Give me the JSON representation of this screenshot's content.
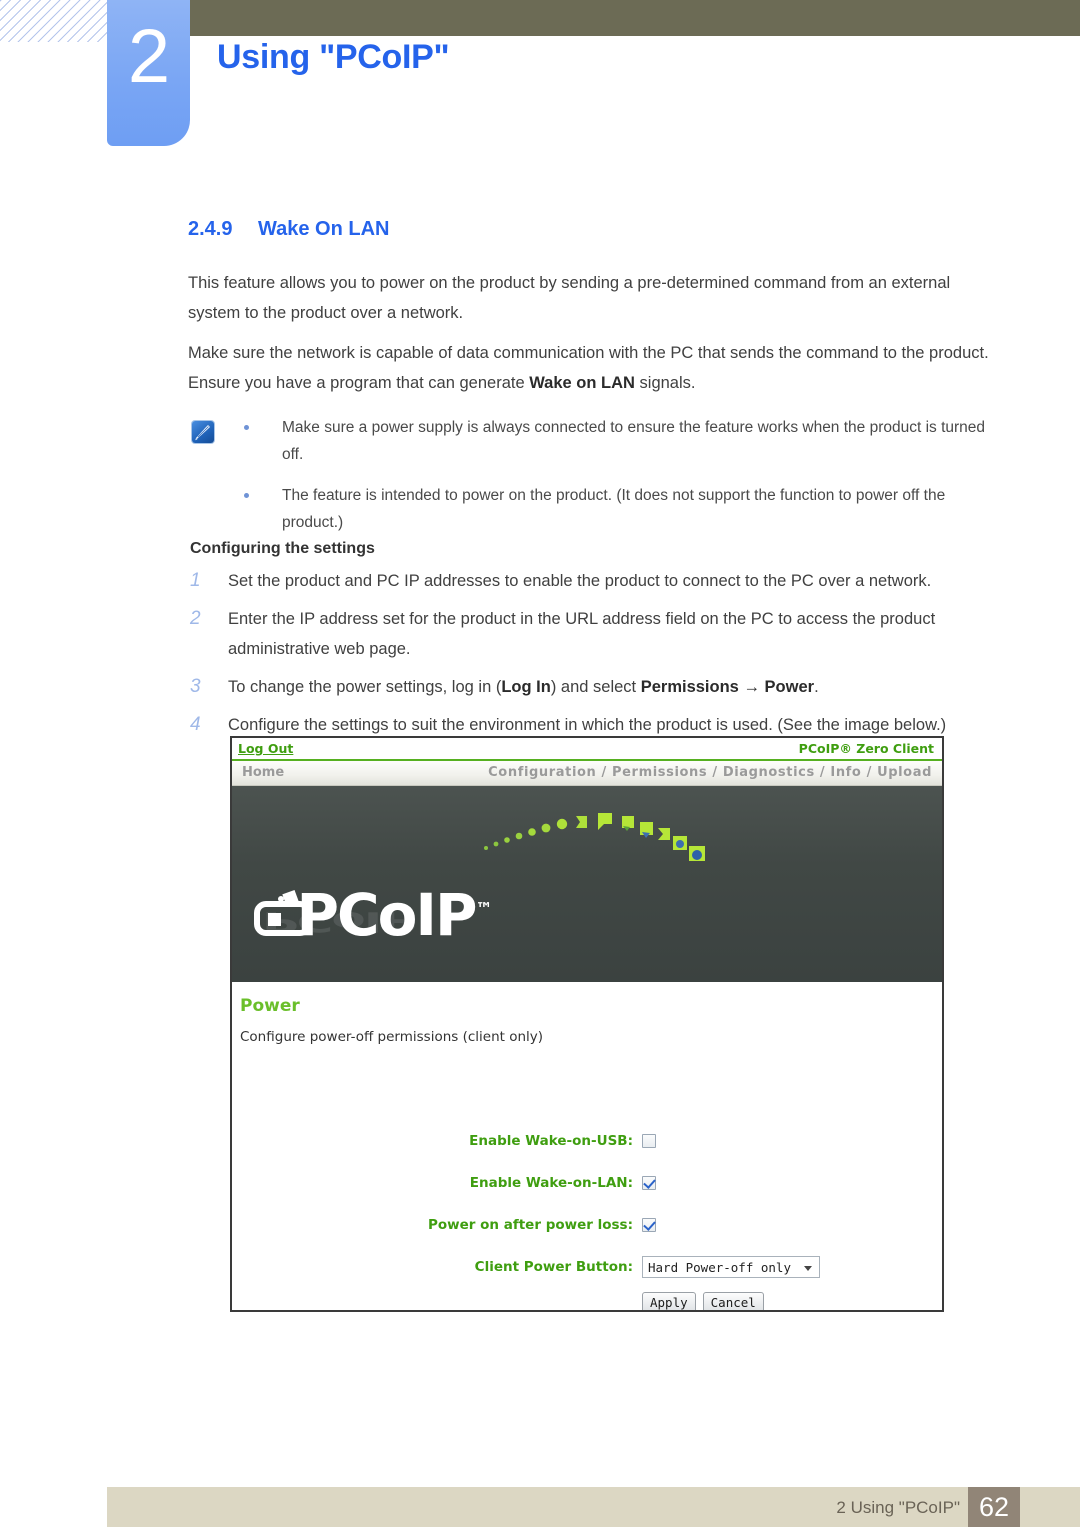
{
  "header": {
    "chapter_number": "2",
    "chapter_title": "Using \"PCoIP\"",
    "accent_blue": "#2563eb",
    "olive": "#6c6b55"
  },
  "section": {
    "number": "2.4.9",
    "title": "Wake On LAN"
  },
  "paragraphs": {
    "p1": "This feature allows you to power on the product by sending a pre-determined command from an external system to the product over a network.",
    "p2_before": "Make sure the network is capable of data communication with the PC that sends the command to the product. Ensure you have a program that can generate ",
    "p2_bold": "Wake on LAN",
    "p2_after": " signals."
  },
  "note": {
    "icon": "note-pen-icon",
    "items": [
      "Make sure a power supply is always connected to ensure the feature works when the product is turned off.",
      "The feature is intended to power on the product. (It does not support the function to power off the product.)"
    ]
  },
  "steps": {
    "title": "Configuring the settings",
    "items": [
      {
        "num": "1",
        "text": "Set the product and PC IP addresses to enable the product to connect to the PC over a network."
      },
      {
        "num": "2",
        "text": "Enter the IP address set for the product in the URL address field on the PC to access the product administrative web page."
      },
      {
        "num": "3",
        "text_before": "To change the power settings, log in (",
        "bold1": "Log In",
        "text_mid": ") and select ",
        "bold2": "Permissions",
        "arrow": "→",
        "bold3": "Power",
        "text_after": "."
      },
      {
        "num": "4",
        "text": "Configure the settings to suit the environment in which the product is used. (See the image below.)"
      }
    ]
  },
  "screenshot": {
    "topbar": {
      "logout_label": "Log Out",
      "brand_label": "PCoIP® Zero Client",
      "green": "#3f9e10"
    },
    "navbar": {
      "home_label": "Home",
      "links_label": "Configuration / Permissions / Diagnostics / Info / Upload"
    },
    "hero": {
      "logo_text": "PCoIP",
      "trademark": "™"
    },
    "panel": {
      "title": "Power",
      "subtitle": "Configure power-off permissions (client only)"
    },
    "fields": [
      {
        "label": "Enable Wake-on-USB:",
        "type": "checkbox",
        "checked": false
      },
      {
        "label": "Enable Wake-on-LAN:",
        "type": "checkbox",
        "checked": true
      },
      {
        "label": "Power on after power loss:",
        "type": "checkbox",
        "checked": true
      },
      {
        "label": "Client Power Button:",
        "type": "select",
        "value": "Hard Power-off only"
      }
    ],
    "buttons": {
      "apply_label": "Apply",
      "cancel_label": "Cancel"
    }
  },
  "footer": {
    "text": "2 Using \"PCoIP\"",
    "page_number": "62"
  }
}
